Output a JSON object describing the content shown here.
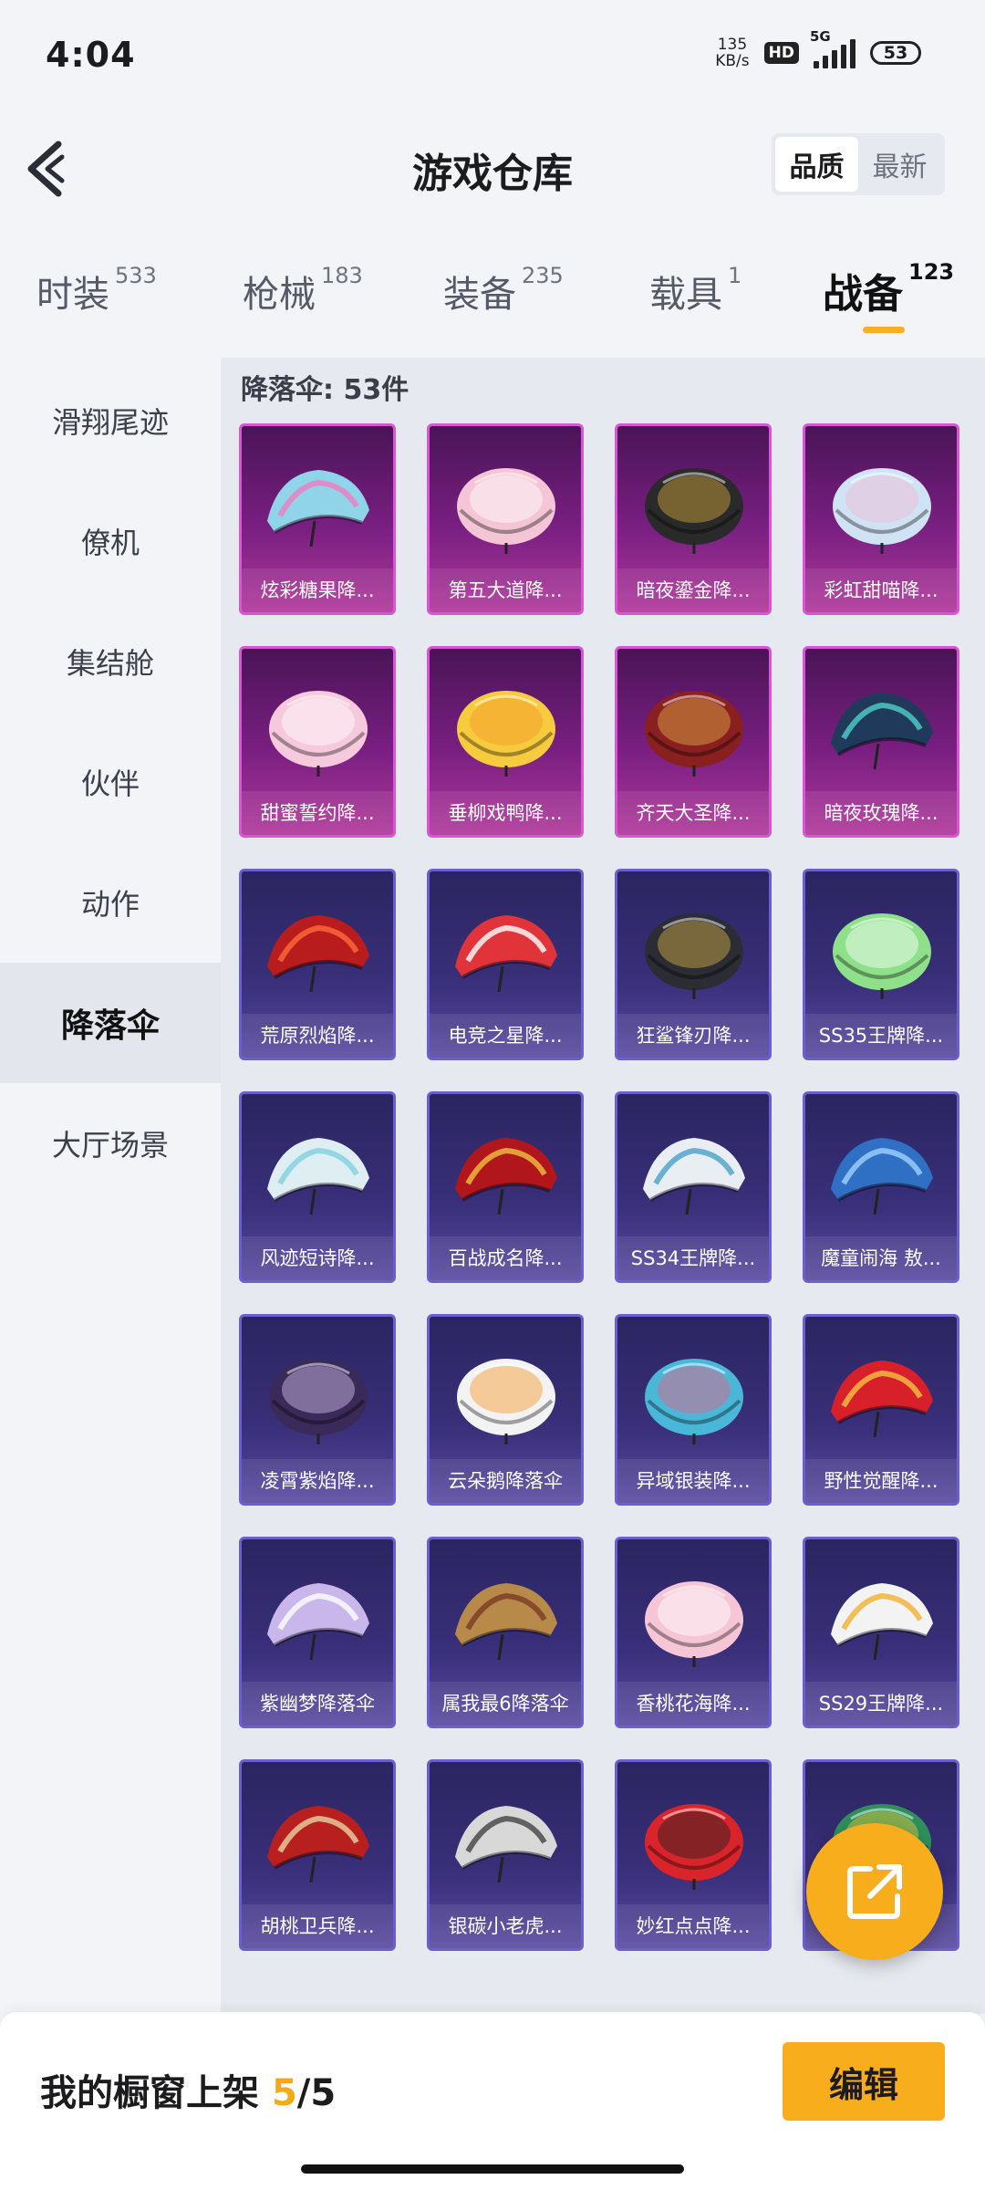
{
  "status_bar": {
    "time": "4:04",
    "net_speed_value": "135",
    "net_speed_unit": "KB/s",
    "hd": "HD",
    "network": "5G",
    "battery": "53"
  },
  "header": {
    "title": "游戏仓库",
    "sort_options": [
      "品质",
      "最新"
    ],
    "sort_selected": "品质"
  },
  "tabs": [
    {
      "label": "时装",
      "count": "533"
    },
    {
      "label": "枪械",
      "count": "183"
    },
    {
      "label": "装备",
      "count": "235"
    },
    {
      "label": "载具",
      "count": "1"
    },
    {
      "label": "战备",
      "count": "123",
      "active": true
    }
  ],
  "sidebar": {
    "items": [
      "滑翔尾迹",
      "僚机",
      "集结舱",
      "伙伴",
      "动作",
      "降落伞",
      "大厅场景"
    ],
    "selected": "降落伞"
  },
  "section": {
    "label": "降落伞: 53件"
  },
  "items": [
    {
      "name": "炫彩糖果降...",
      "tier": "purple",
      "color": "#8fd4e8",
      "accent": "#f07cc0",
      "shape": "wing"
    },
    {
      "name": "第五大道降...",
      "tier": "purple",
      "color": "#f3c5d5",
      "accent": "#ffffff",
      "shape": "dome"
    },
    {
      "name": "暗夜鎏金降...",
      "tier": "purple",
      "color": "#2a2a2a",
      "accent": "#d4a93a",
      "shape": "dome"
    },
    {
      "name": "彩虹甜喵降...",
      "tier": "purple",
      "color": "#cfe3f4",
      "accent": "#f4b7d3",
      "shape": "dome"
    },
    {
      "name": "甜蜜誓约降...",
      "tier": "purple",
      "color": "#f6c9dc",
      "accent": "#ffffff",
      "shape": "dome"
    },
    {
      "name": "垂柳戏鸭降...",
      "tier": "purple",
      "color": "#f6cb3d",
      "accent": "#f39a2a",
      "shape": "dome"
    },
    {
      "name": "齐天大圣降...",
      "tier": "purple",
      "color": "#8a1f1f",
      "accent": "#e0b04a",
      "shape": "dome"
    },
    {
      "name": "暗夜玫瑰降...",
      "tier": "purple",
      "color": "#1f3a5a",
      "accent": "#4fd0c8",
      "shape": "wing"
    },
    {
      "name": "荒原烈焰降...",
      "tier": "blue",
      "color": "#b81c1c",
      "accent": "#ff6a3a",
      "shape": "wing"
    },
    {
      "name": "电竞之星降...",
      "tier": "blue",
      "color": "#e0343a",
      "accent": "#ffffff",
      "shape": "wing"
    },
    {
      "name": "狂鲨锋刃降...",
      "tier": "blue",
      "color": "#2c2c34",
      "accent": "#d9b24a",
      "shape": "dome"
    },
    {
      "name": "SS35王牌降...",
      "tier": "blue",
      "color": "#8fe08a",
      "accent": "#ffffff",
      "shape": "dome"
    },
    {
      "name": "风迹短诗降...",
      "tier": "blue",
      "color": "#dfeef2",
      "accent": "#7fd0e0",
      "shape": "wing"
    },
    {
      "name": "百战成名降...",
      "tier": "blue",
      "color": "#b0161c",
      "accent": "#f0c040",
      "shape": "wing"
    },
    {
      "name": "SS34王牌降...",
      "tier": "blue",
      "color": "#e9eef2",
      "accent": "#4aa0c8",
      "shape": "wing"
    },
    {
      "name": "魔童闹海 敖...",
      "tier": "blue",
      "color": "#2f6fc4",
      "accent": "#9fd2ff",
      "shape": "wing"
    },
    {
      "name": "凌霄紫焰降...",
      "tier": "blue",
      "color": "#3a2a5a",
      "accent": "#d7c3f0",
      "shape": "dome"
    },
    {
      "name": "云朵鹅降落伞",
      "tier": "blue",
      "color": "#f3f3f3",
      "accent": "#f59a2a",
      "shape": "dome"
    },
    {
      "name": "异域银装降...",
      "tier": "blue",
      "color": "#4ab6d8",
      "accent": "#f06080",
      "shape": "dome"
    },
    {
      "name": "野性觉醒降...",
      "tier": "blue",
      "color": "#d8202a",
      "accent": "#f5c242",
      "shape": "wing"
    },
    {
      "name": "紫幽梦降落伞",
      "tier": "blue",
      "color": "#c9b6ea",
      "accent": "#ffffff",
      "shape": "wing"
    },
    {
      "name": "属我最6降落伞",
      "tier": "blue",
      "color": "#b88a4a",
      "accent": "#7a3a22",
      "shape": "wing"
    },
    {
      "name": "香桃花海降...",
      "tier": "blue",
      "color": "#f6c6d6",
      "accent": "#ffffff",
      "shape": "dome"
    },
    {
      "name": "SS29王牌降...",
      "tier": "blue",
      "color": "#f3f3f3",
      "accent": "#f0b030",
      "shape": "wing"
    },
    {
      "name": "胡桃卫兵降...",
      "tier": "blue",
      "color": "#b82020",
      "accent": "#e8d2a0",
      "shape": "wing"
    },
    {
      "name": "银碳小老虎...",
      "tier": "blue",
      "color": "#d8d8d8",
      "accent": "#444444",
      "shape": "wing"
    },
    {
      "name": "妙红点点降...",
      "tier": "blue",
      "color": "#d8242a",
      "accent": "#222222",
      "shape": "dome"
    },
    {
      "name": "",
      "tier": "blue",
      "color": "#2e8f5a",
      "accent": "#f0d040",
      "shape": "dome"
    }
  ],
  "bottom_bar": {
    "shelf_label": "我的橱窗上架",
    "shelf_current": "5",
    "shelf_sep": "/",
    "shelf_total": "5",
    "edit_label": "编辑"
  },
  "colors": {
    "accent": "#f8ad1c",
    "purple_tier": "#d855d5",
    "blue_tier": "#6d5ed0"
  },
  "icons": {
    "back": "chevron-left-icon",
    "fab": "share-export-icon"
  }
}
